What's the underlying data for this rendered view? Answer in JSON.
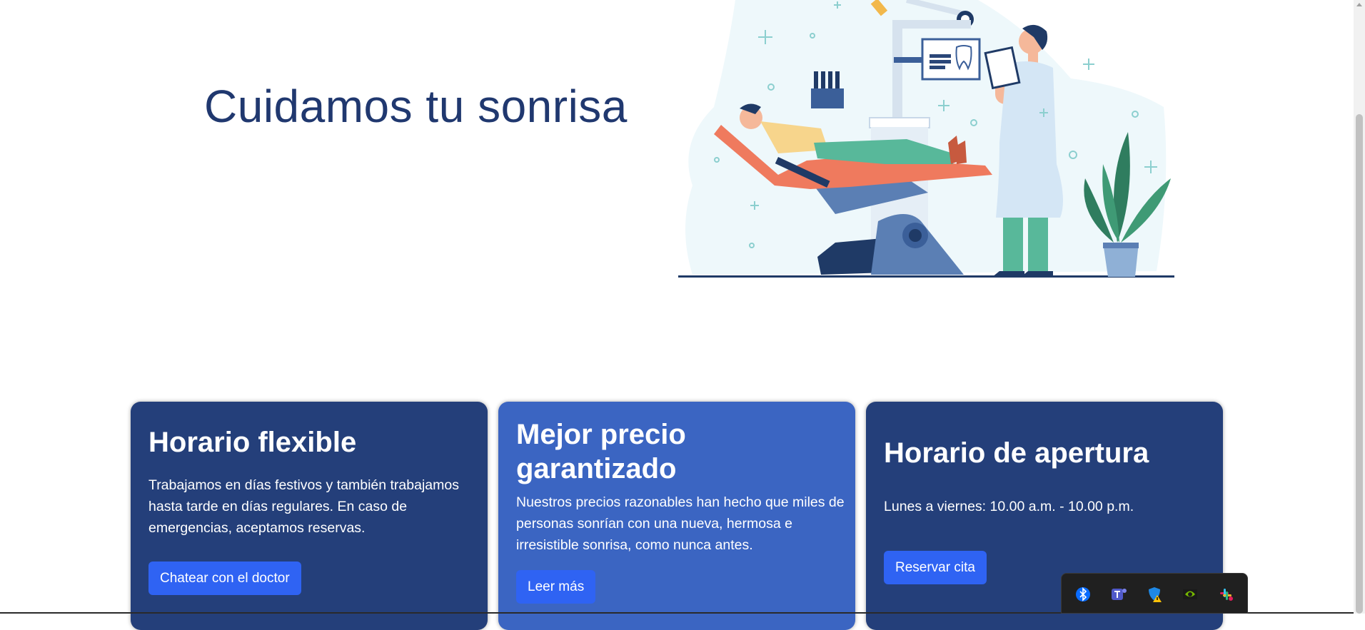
{
  "hero": {
    "title": "Cuidamos tu sonrisa"
  },
  "cards": [
    {
      "title": "Horario flexible",
      "text": "Trabajamos en días festivos y también trabajamos hasta tarde en días regulares. En caso de emergencias, aceptamos reservas.",
      "button": "Chatear con el doctor"
    },
    {
      "title_line1": "Mejor precio",
      "title_line2": "garantizado",
      "text": "Nuestros precios razonables han hecho que miles de personas sonrían con una nueva, hermosa e irresistible sonrisa, como nunca antes.",
      "button": "Leer más"
    },
    {
      "title": "Horario de apertura",
      "text": "Lunes a viernes: 10.00 a.m. - 10.00 p.m.",
      "button": "Reservar cita"
    }
  ],
  "colors": {
    "primary_dark": "#243f7a",
    "primary_mid": "#3b65c2",
    "button": "#2f63f3",
    "title": "#20386f"
  },
  "tray_icons": [
    "bluetooth-icon",
    "teams-icon",
    "defender-warning-icon",
    "nvidia-icon",
    "slack-icon"
  ]
}
